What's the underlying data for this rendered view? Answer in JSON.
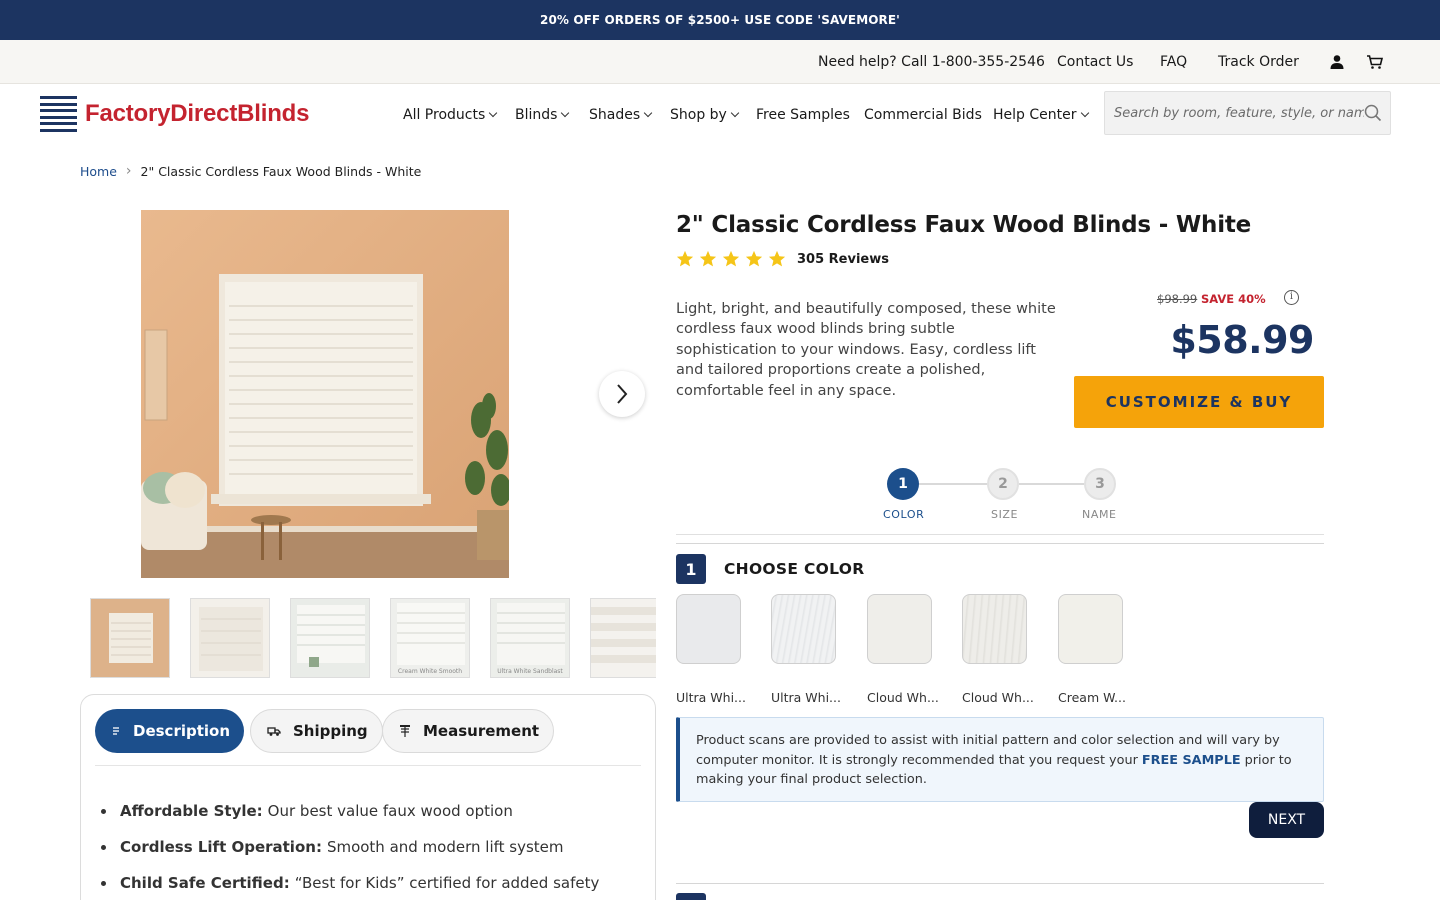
{
  "promo": {
    "text": "20% OFF ORDERS OF $2500+ USE CODE 'SAVEMORE'"
  },
  "utility": {
    "help": "Need help? Call 1-800-355-2546",
    "contact": "Contact Us",
    "faq": "FAQ",
    "track": "Track Order",
    "account_icon": "user-icon",
    "cart_icon": "cart-icon"
  },
  "brand": {
    "name": "FactoryDirectBlinds",
    "color": "#c4232f",
    "navy": "#1c3461"
  },
  "nav": {
    "all_products": "All Products",
    "blinds": "Blinds",
    "shades": "Shades",
    "shop_by": "Shop by",
    "free_samples": "Free Samples",
    "commercial": "Commercial Bids",
    "help": "Help Center"
  },
  "search": {
    "placeholder": "Search by room, feature, style, or name",
    "icon": "search-icon"
  },
  "breadcrumb": {
    "home": "Home",
    "current": "2\" Classic Cordless Faux Wood Blinds - White"
  },
  "gallery": {
    "thumb_captions": [
      "",
      "",
      "",
      "Cream White Smooth",
      "Ultra White Sandblast",
      ""
    ]
  },
  "product": {
    "title": "2\" Classic Cordless Faux Wood Blinds - White",
    "rating": 5,
    "reviews": "305 Reviews",
    "description": "Light, bright, and beautifully composed, these white cordless faux wood blinds bring subtle sophistication to your windows. Easy, cordless lift and tailored proportions create a polished, comfortable feel in any space.",
    "old_price": "$98.99",
    "save": "SAVE 40%",
    "price": "$58.99",
    "buy_label": "CUSTOMIZE & BUY",
    "accent": "#f5a30a"
  },
  "steps": [
    {
      "num": "1",
      "label": "COLOR"
    },
    {
      "num": "2",
      "label": "SIZE"
    },
    {
      "num": "3",
      "label": "NAME"
    }
  ],
  "color_section": {
    "num": "1",
    "title": "CHOOSE COLOR"
  },
  "swatches": [
    "Ultra Whi...",
    "Ultra Whi...",
    "Cloud Wh...",
    "Cloud Wh...",
    "Cream W..."
  ],
  "notice": {
    "before": "Product scans are provided to assist with initial pattern and color selection and will vary by computer monitor. It is strongly recommended that you request your",
    "link": "FREE SAMPLE",
    "after": "prior to making your final product selection."
  },
  "next_label": "NEXT",
  "tabs": {
    "description": "Description",
    "shipping": "Shipping",
    "measurement": "Measurement"
  },
  "bullets": [
    {
      "title": "Affordable Style:",
      "text": "Our best value faux wood option"
    },
    {
      "title": "Cordless Lift Operation:",
      "text": "Smooth and modern lift system"
    },
    {
      "title": "Child Safe Certified:",
      "text": "“Best for Kids” certified for added safety"
    }
  ]
}
